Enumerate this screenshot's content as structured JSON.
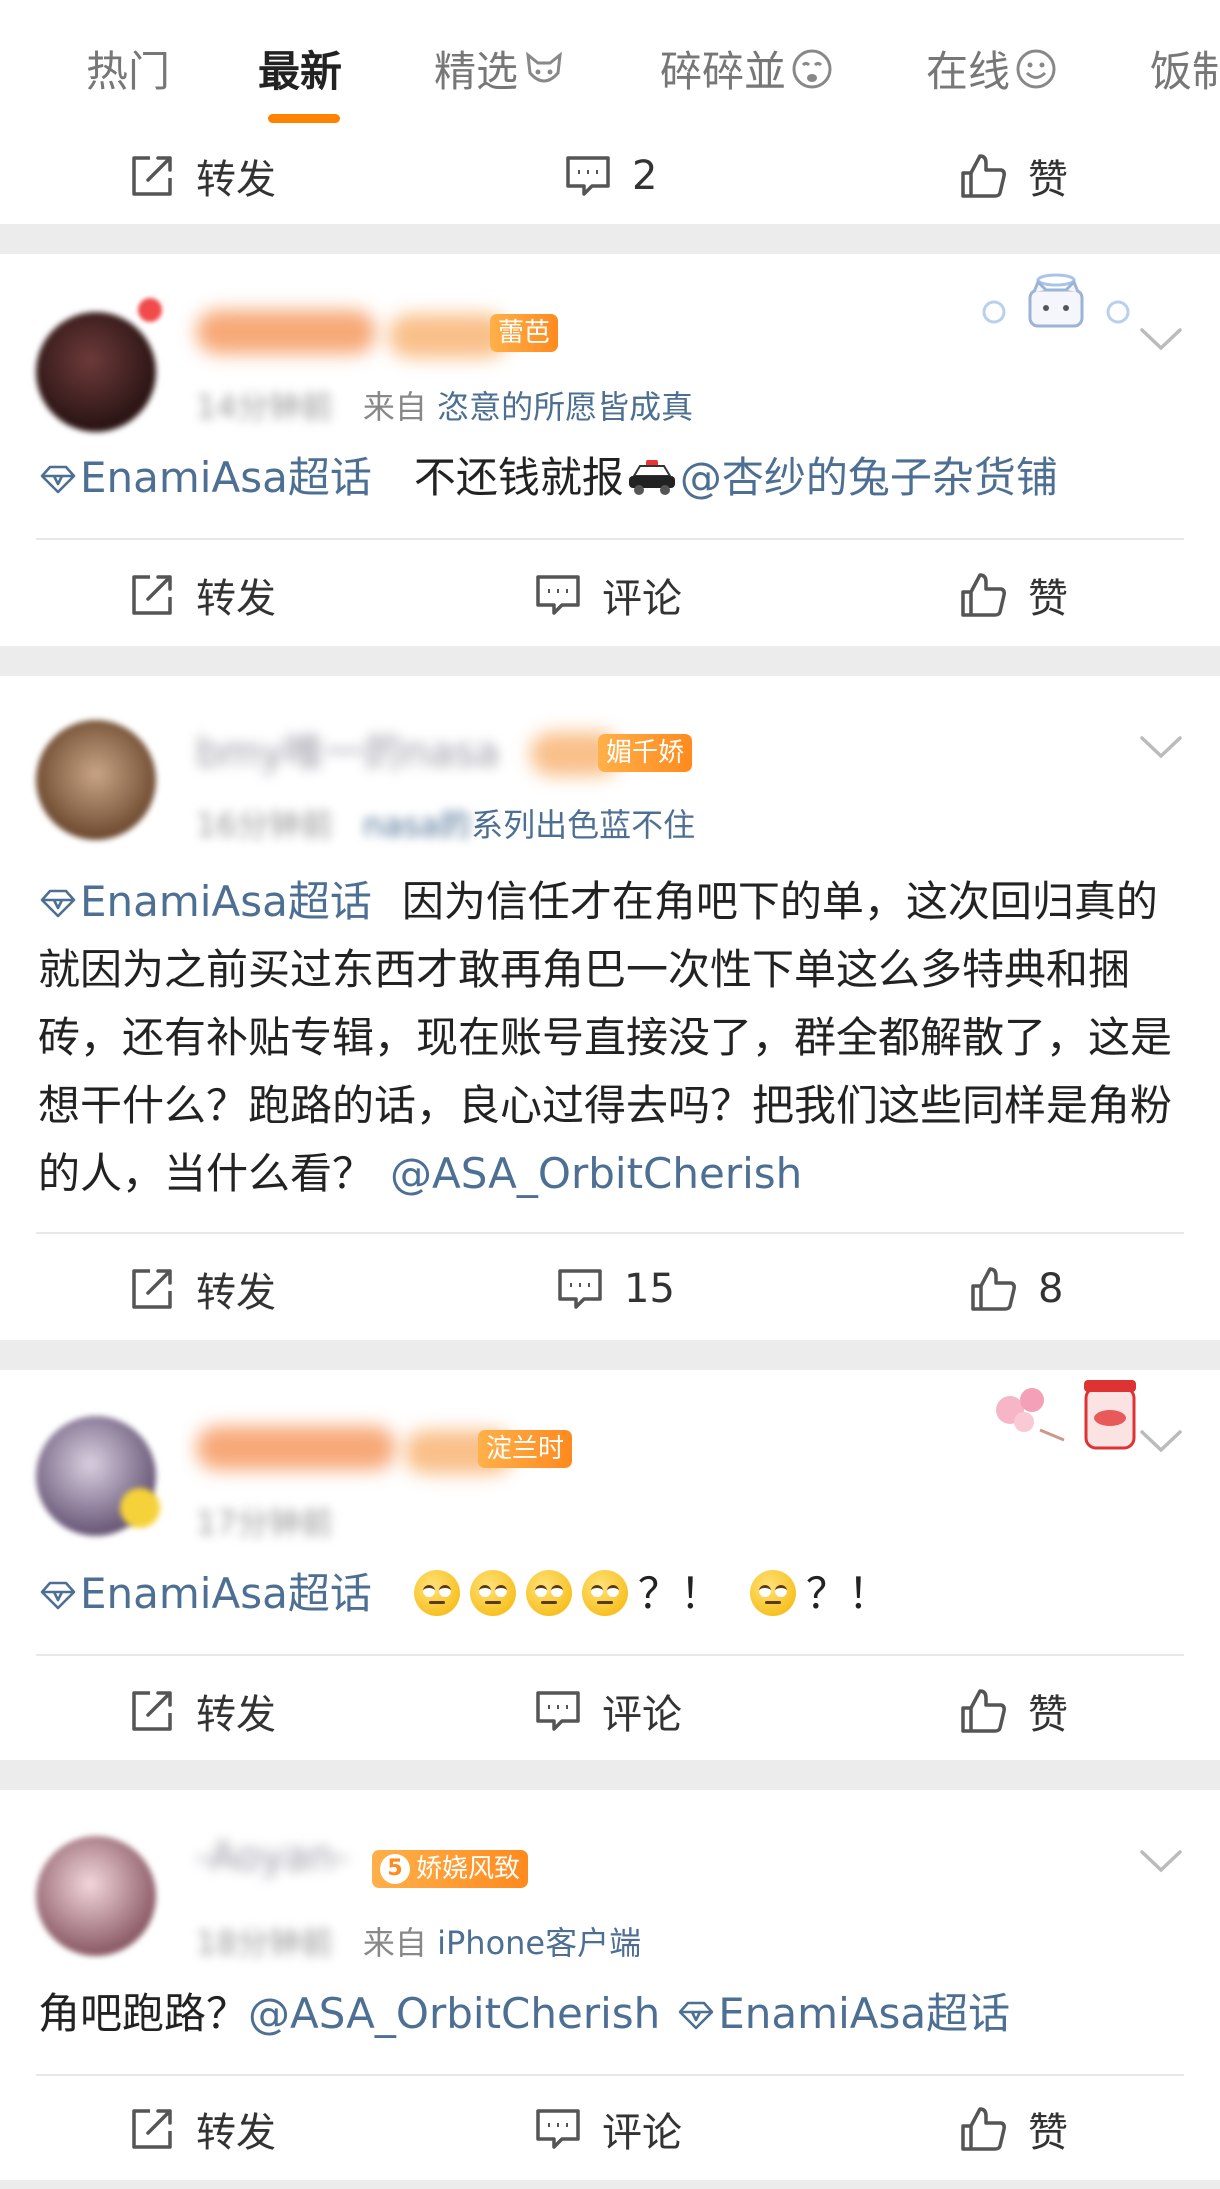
{
  "tabs": [
    {
      "label": "热门",
      "active": false,
      "icon": null
    },
    {
      "label": "最新",
      "active": true,
      "icon": null
    },
    {
      "label": "精选",
      "active": false,
      "icon": "fox-emoji-icon"
    },
    {
      "label": "碎碎並",
      "active": false,
      "icon": "crying-emoji-icon"
    },
    {
      "label": "在线",
      "active": false,
      "icon": "smile-emoji-icon"
    },
    {
      "label": "饭制",
      "active": false,
      "icon": null
    }
  ],
  "top_actions": {
    "repost": "转发",
    "comment": "2",
    "like": "赞"
  },
  "accent_color": "#ff8200",
  "link_color": "#4d6f93",
  "posts": [
    {
      "badge": "蕾芭",
      "time": "14分钟前",
      "from_prefix": "来自",
      "source": "恣意的所愿皆成真",
      "topic": "EnamiAsa超话",
      "text_before": "不还钱就报",
      "mention": "@杏纱的兔子杂货铺",
      "actions": {
        "repost": "转发",
        "comment": "评论",
        "like": "赞"
      }
    },
    {
      "name_partial": "bmy唯一的nasa",
      "badge": "媚千娇",
      "time": "16分钟前",
      "source_blur": "nasa的",
      "source": "系列出色蓝不住",
      "topic": "EnamiAsa超话",
      "text": "因为信任才在角吧下的单，这次回归真的就因为之前买过东西才敢再角巴一次性下单这么多特典和捆砖，还有补贴专辑，现在账号直接没了，群全都解散了，这是想干什么？跑路的话，良心过得去吗？把我们这些同样是角粉的人，当什么看？",
      "mention": "@ASA_OrbitCherish",
      "actions": {
        "repost": "转发",
        "comment": "15",
        "like": "8"
      }
    },
    {
      "badge": "淀兰时",
      "time": "17分钟前",
      "topic": "EnamiAsa超话",
      "punct_1": "？！",
      "punct_2": "？！",
      "actions": {
        "repost": "转发",
        "comment": "评论",
        "like": "赞"
      }
    },
    {
      "name_partial": "-Aoyan-",
      "badge_level": "5",
      "badge": "娇娆风致",
      "time": "18分钟前",
      "from_prefix": "来自",
      "source": "iPhone客户端",
      "text_before": "角吧跑路？",
      "mention": "@ASA_OrbitCherish",
      "topic": "EnamiAsa超话",
      "actions": {
        "repost": "转发",
        "comment": "评论",
        "like": "赞"
      }
    }
  ]
}
